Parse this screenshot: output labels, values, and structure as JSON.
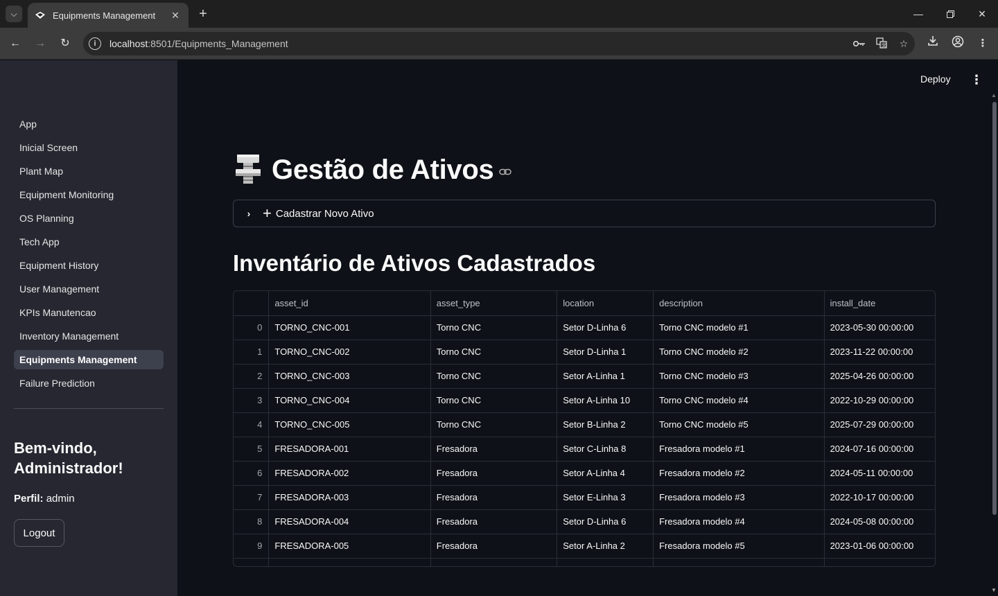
{
  "browser": {
    "tab_title": "Equipments Management",
    "url_host": "localhost",
    "url_rest": ":8501/Equipments_Management"
  },
  "sidebar": {
    "items": [
      {
        "label": "App"
      },
      {
        "label": "Inicial Screen"
      },
      {
        "label": "Plant Map"
      },
      {
        "label": "Equipment Monitoring"
      },
      {
        "label": "OS Planning"
      },
      {
        "label": "Tech App"
      },
      {
        "label": "Equipment History"
      },
      {
        "label": "User Management"
      },
      {
        "label": "KPIs Manutencao"
      },
      {
        "label": "Inventory Management"
      },
      {
        "label": "Equipments Management",
        "active": true
      },
      {
        "label": "Failure Prediction"
      }
    ],
    "welcome": "Bem-vindo, Administrador!",
    "profile_label": "Perfil:",
    "profile_value": "admin",
    "logout_label": "Logout"
  },
  "header": {
    "deploy_label": "Deploy"
  },
  "main": {
    "title": "Gestão de Ativos",
    "expander_label": "Cadastrar Novo Ativo",
    "section_title": "Inventário de Ativos Cadastrados"
  },
  "table": {
    "columns": [
      "",
      "asset_id",
      "asset_type",
      "location",
      "description",
      "install_date"
    ],
    "rows": [
      [
        "0",
        "TORNO_CNC-001",
        "Torno CNC",
        "Setor D-Linha 6",
        "Torno CNC modelo #1",
        "2023-05-30 00:00:00"
      ],
      [
        "1",
        "TORNO_CNC-002",
        "Torno CNC",
        "Setor D-Linha 1",
        "Torno CNC modelo #2",
        "2023-11-22 00:00:00"
      ],
      [
        "2",
        "TORNO_CNC-003",
        "Torno CNC",
        "Setor A-Linha 1",
        "Torno CNC modelo #3",
        "2025-04-26 00:00:00"
      ],
      [
        "3",
        "TORNO_CNC-004",
        "Torno CNC",
        "Setor A-Linha 10",
        "Torno CNC modelo #4",
        "2022-10-29 00:00:00"
      ],
      [
        "4",
        "TORNO_CNC-005",
        "Torno CNC",
        "Setor B-Linha 2",
        "Torno CNC modelo #5",
        "2025-07-29 00:00:00"
      ],
      [
        "5",
        "FRESADORA-001",
        "Fresadora",
        "Setor C-Linha 8",
        "Fresadora modelo #1",
        "2024-07-16 00:00:00"
      ],
      [
        "6",
        "FRESADORA-002",
        "Fresadora",
        "Setor A-Linha 4",
        "Fresadora modelo #2",
        "2024-05-11 00:00:00"
      ],
      [
        "7",
        "FRESADORA-003",
        "Fresadora",
        "Setor E-Linha 3",
        "Fresadora modelo #3",
        "2022-10-17 00:00:00"
      ],
      [
        "8",
        "FRESADORA-004",
        "Fresadora",
        "Setor D-Linha 6",
        "Fresadora modelo #4",
        "2024-05-08 00:00:00"
      ],
      [
        "9",
        "FRESADORA-005",
        "Fresadora",
        "Setor A-Linha 2",
        "Fresadora modelo #5",
        "2023-01-06 00:00:00"
      ]
    ]
  },
  "colors": {
    "app_bg": "#0e1117",
    "sidebar_bg": "#262730",
    "active_item_bg": "#3d404d",
    "text": "#fafafa"
  }
}
